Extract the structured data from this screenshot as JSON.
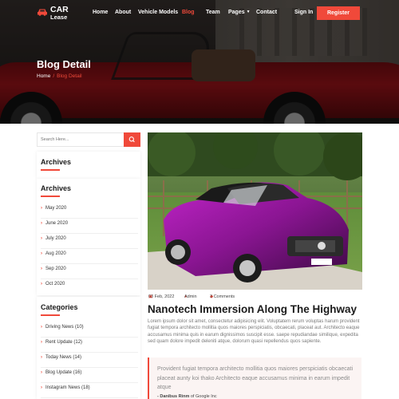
{
  "brand": {
    "line1": "CAR",
    "line2": "Lease",
    "accent": "#f0493a"
  },
  "nav": {
    "items": [
      "Home",
      "About",
      "Vehicle Models",
      "Blog",
      "Team",
      "Pages",
      "Contact"
    ],
    "active": "Blog",
    "signin": "Sign In",
    "register": "Register"
  },
  "hero": {
    "title": "Blog Detail",
    "breadcrumb": {
      "home": "Home",
      "separator": "/",
      "current": "Blog Detail"
    }
  },
  "sidebar": {
    "search_placeholder": "Search Here...",
    "archives_title_1": "Archives",
    "archives_title_2": "Archives",
    "archives": [
      "May 2020",
      "June 2020",
      "July 2020",
      "Aug 2020",
      "Sep 2020",
      "Oct 2020"
    ],
    "categories_title": "Categories",
    "categories": [
      "Driving News (10)",
      "Rent Update (12)",
      "Today News (14)",
      "Blog Update (16)",
      "Instagram News (18)"
    ]
  },
  "post": {
    "date": "03 Feb, 2022",
    "author": "Admin",
    "comments": "3 Comments",
    "title": "Nanotech Immersion Along The Highway",
    "body": "Lorem ipsum dolor sit amet, consectetur adipisicing elit. Voluptatem rerum voluptas harum provident fugiat tempora architecto mollitia quos maiores perspiciatis, obcaecati, placeat aut. Architecto eaque accusamus minima quis in earum dignissimos suscipit esse. saepe repudiandae similique, expedita sed quam dolore impedit deleniti atque, dolorum quasi repellendus quos sapiente.",
    "quote": "Provident fugiat tempora architecto mollitia quos maiores perspiciatis obcaecati placeat aunty koi thako Architecto eaque accusamus minima in earum impedit atque",
    "quote_author": "- Danibus Rinm",
    "quote_org": " of Google Inc"
  }
}
